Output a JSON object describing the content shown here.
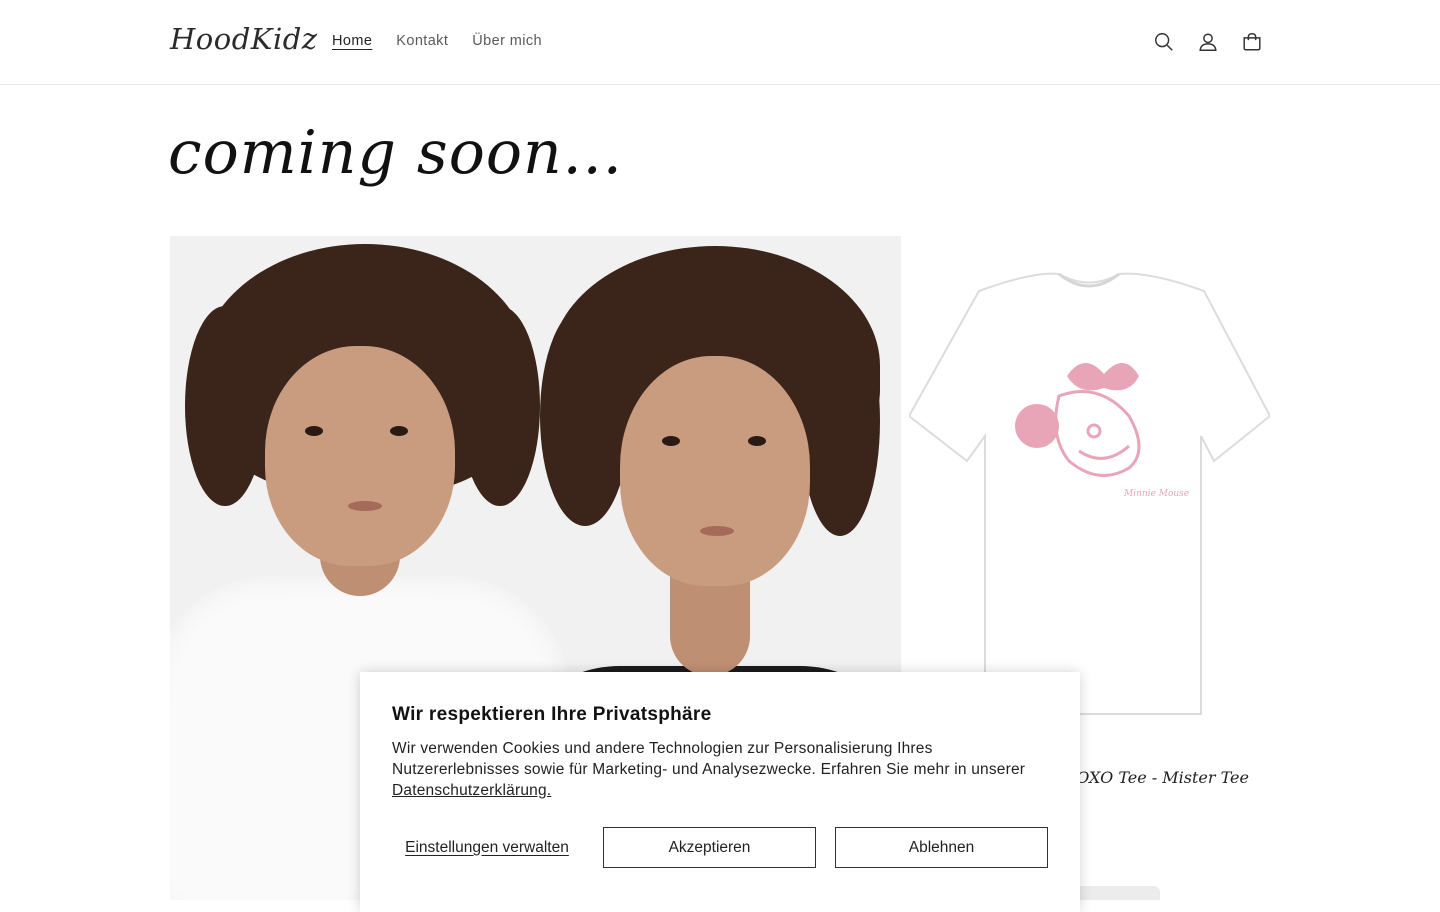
{
  "header": {
    "logo": "HoodKidz",
    "nav": [
      {
        "label": "Home",
        "active": true
      },
      {
        "label": "Kontakt",
        "active": false
      },
      {
        "label": "Über mich",
        "active": false
      }
    ],
    "icons": [
      "search-icon",
      "account-icon",
      "cart-icon"
    ]
  },
  "main": {
    "headline": "coming soon...",
    "product": {
      "title": "XOXO Tee - Mister Tee",
      "print_color": "#e8a5b8"
    }
  },
  "cookie_banner": {
    "title": "Wir respektieren Ihre Privatsphäre",
    "text": "Wir verwenden Cookies und andere Technologien zur Personalisierung Ihres Nutzererlebnisses sowie für Marketing- und Analysezwecke. Erfahren Sie mehr in unserer",
    "link": "Datenschutzerklärung.",
    "manage_label": "Einstellungen verwalten",
    "accept_label": "Akzeptieren",
    "decline_label": "Ablehnen"
  }
}
